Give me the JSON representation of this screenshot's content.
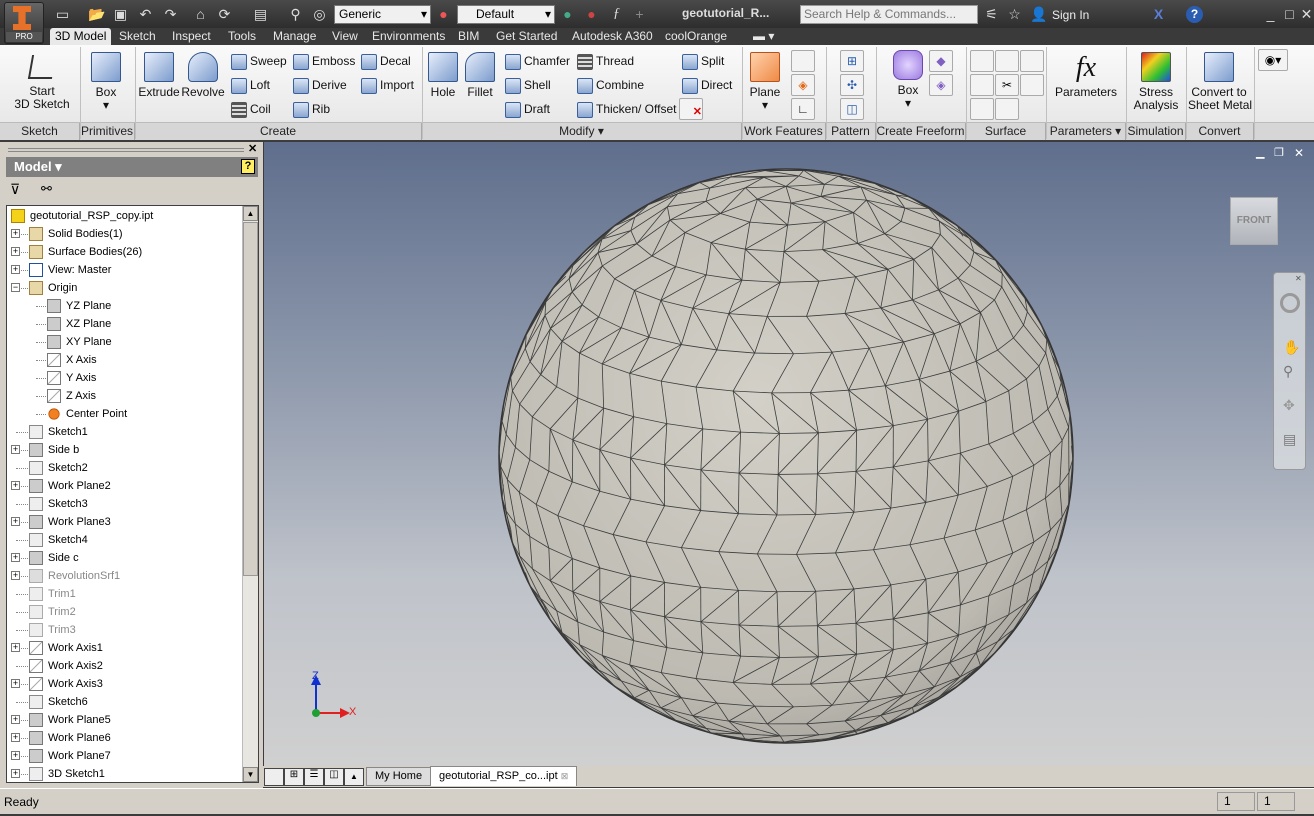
{
  "titlebar": {
    "app_badge": "PRO",
    "material": "Generic",
    "appearance": "Default",
    "doc_title": "geotutorial_R...",
    "search_placeholder": "Search Help & Commands...",
    "sign_in": "Sign In",
    "help": "?"
  },
  "tabs": [
    "3D Model",
    "Sketch",
    "Inspect",
    "Tools",
    "Manage",
    "View",
    "Environments",
    "BIM",
    "Get Started",
    "Autodesk A360",
    "coolOrange"
  ],
  "ribbon": {
    "sketch": {
      "start": "Start",
      "sketch3d": "3D Sketch",
      "label": "Sketch"
    },
    "primitives": {
      "box": "Box",
      "label": "Primitives"
    },
    "create": {
      "extrude": "Extrude",
      "revolve": "Revolve",
      "sweep": "Sweep",
      "loft": "Loft",
      "coil": "Coil",
      "emboss": "Emboss",
      "derive": "Derive",
      "rib": "Rib",
      "decal": "Decal",
      "import": "Import",
      "label": "Create"
    },
    "modify": {
      "hole": "Hole",
      "fillet": "Fillet",
      "chamfer": "Chamfer",
      "shell": "Shell",
      "draft": "Draft",
      "thread": "Thread",
      "combine": "Combine",
      "thicken": "Thicken/ Offset",
      "split": "Split",
      "direct": "Direct",
      "label": "Modify ▾"
    },
    "work_features": {
      "plane": "Plane",
      "label": "Work Features"
    },
    "pattern": {
      "label": "Pattern"
    },
    "freeform": {
      "box": "Box",
      "label": "Create Freeform"
    },
    "surface": {
      "label": "Surface"
    },
    "parameters": {
      "fx": "fx",
      "parameters": "Parameters",
      "label": "Parameters ▾"
    },
    "simulation": {
      "stress1": "Stress",
      "stress2": "Analysis",
      "label": "Simulation"
    },
    "convert": {
      "c1": "Convert to",
      "c2": "Sheet Metal",
      "label": "Convert"
    }
  },
  "browser": {
    "title": "Model ▾",
    "tree": [
      {
        "label": "geotutorial_RSP_copy.ipt",
        "level": 0,
        "exp": "",
        "icon": "part-icon"
      },
      {
        "label": "Solid Bodies(1)",
        "level": 1,
        "exp": "+",
        "icon": "folder-icon"
      },
      {
        "label": "Surface Bodies(26)",
        "level": 1,
        "exp": "+",
        "icon": "folder-icon"
      },
      {
        "label": "View: Master",
        "level": 1,
        "exp": "+",
        "icon": "view-icon"
      },
      {
        "label": "Origin",
        "level": 1,
        "exp": "-",
        "icon": "folder-open-icon"
      },
      {
        "label": "YZ Plane",
        "level": 2,
        "exp": "",
        "icon": "plane-icon"
      },
      {
        "label": "XZ Plane",
        "level": 2,
        "exp": "",
        "icon": "plane-icon"
      },
      {
        "label": "XY Plane",
        "level": 2,
        "exp": "",
        "icon": "plane-icon"
      },
      {
        "label": "X Axis",
        "level": 2,
        "exp": "",
        "icon": "axis-icon"
      },
      {
        "label": "Y Axis",
        "level": 2,
        "exp": "",
        "icon": "axis-icon"
      },
      {
        "label": "Z Axis",
        "level": 2,
        "exp": "",
        "icon": "axis-icon"
      },
      {
        "label": "Center Point",
        "level": 2,
        "exp": "",
        "icon": "point-icon"
      },
      {
        "label": "Sketch1",
        "level": 1,
        "exp": "",
        "icon": "sketch-icon"
      },
      {
        "label": "Side b",
        "level": 1,
        "exp": "+",
        "icon": "plane-icon"
      },
      {
        "label": "Sketch2",
        "level": 1,
        "exp": "",
        "icon": "sketch-icon"
      },
      {
        "label": "Work Plane2",
        "level": 1,
        "exp": "+",
        "icon": "plane-icon"
      },
      {
        "label": "Sketch3",
        "level": 1,
        "exp": "",
        "icon": "sketch-icon"
      },
      {
        "label": "Work Plane3",
        "level": 1,
        "exp": "+",
        "icon": "plane-icon"
      },
      {
        "label": "Sketch4",
        "level": 1,
        "exp": "",
        "icon": "sketch-icon"
      },
      {
        "label": "Side c",
        "level": 1,
        "exp": "+",
        "icon": "plane-icon"
      },
      {
        "label": "RevolutionSrf1",
        "level": 1,
        "exp": "+",
        "icon": "revolve-icon",
        "gray": true
      },
      {
        "label": "Trim1",
        "level": 1,
        "exp": "",
        "icon": "trim-icon",
        "gray": true
      },
      {
        "label": "Trim2",
        "level": 1,
        "exp": "",
        "icon": "trim-icon",
        "gray": true
      },
      {
        "label": "Trim3",
        "level": 1,
        "exp": "",
        "icon": "trim-icon",
        "gray": true
      },
      {
        "label": "Work Axis1",
        "level": 1,
        "exp": "+",
        "icon": "axis-icon"
      },
      {
        "label": "Work Axis2",
        "level": 1,
        "exp": "",
        "icon": "axis-icon"
      },
      {
        "label": "Work Axis3",
        "level": 1,
        "exp": "+",
        "icon": "axis-icon"
      },
      {
        "label": "Sketch6",
        "level": 1,
        "exp": "",
        "icon": "sketch-icon"
      },
      {
        "label": "Work Plane5",
        "level": 1,
        "exp": "+",
        "icon": "plane-icon"
      },
      {
        "label": "Work Plane6",
        "level": 1,
        "exp": "+",
        "icon": "plane-icon"
      },
      {
        "label": "Work Plane7",
        "level": 1,
        "exp": "+",
        "icon": "plane-icon"
      },
      {
        "label": "3D Sketch1",
        "level": 1,
        "exp": "+",
        "icon": "sketch3d-icon"
      }
    ]
  },
  "viewport": {
    "viewcube": "FRONT",
    "axis_x": "X",
    "axis_z": "Z",
    "colors": {
      "x": "#e02020",
      "z": "#1030d0",
      "origin": "#20a030"
    }
  },
  "doc_tabs": {
    "home": "My Home",
    "doc": "geotutorial_RSP_co...ipt"
  },
  "status": {
    "text": "Ready",
    "cell1": "1",
    "cell2": "1"
  }
}
